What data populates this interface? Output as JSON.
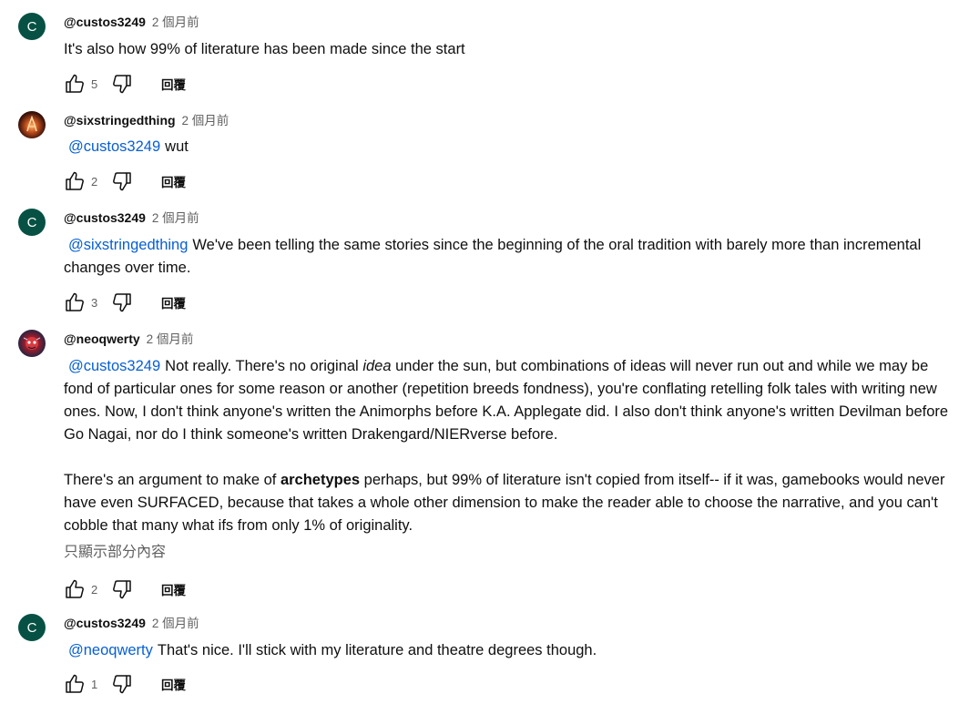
{
  "comments": [
    {
      "author": "@custos3249",
      "time": "2 個月前",
      "avatar_letter": "C",
      "mention": "",
      "text": "It's also how 99% of literature has been made since the start",
      "likes": "5",
      "reply": "回覆"
    },
    {
      "author": "@sixstringedthing",
      "time": "2 個月前",
      "mention": "@custos3249",
      "text": "wut",
      "likes": "2",
      "reply": "回覆"
    },
    {
      "author": "@custos3249",
      "time": "2 個月前",
      "avatar_letter": "C",
      "mention": "@sixstringedthing",
      "text": "We've been telling the same stories since the beginning of the oral tradition with barely more than incremental changes over time.",
      "likes": "3",
      "reply": "回覆"
    },
    {
      "author": "@neoqwerty",
      "time": "2 個月前",
      "mention": "@custos3249",
      "p1_a": "Not really. There's no original ",
      "p1_em": "idea",
      "p1_b": " under the sun, but combinations of ideas will never run out and while we may be fond of particular ones for some reason or another (repetition breeds fondness), you're conflating retelling folk tales with writing new ones. Now, I don't think anyone's written the Animorphs before K.A. Applegate did. I also don't think anyone's written Devilman before Go Nagai, nor do I think someone's written Drakengard/NIERverse before.",
      "p2_a": "There's an argument to make of ",
      "p2_strong": "archetypes",
      "p2_b": " perhaps, but 99% of literature isn't copied from itself-- if it was, gamebooks would never have even SURFACED, because that takes a whole other dimension to make the reader able to choose the narrative, and you can't cobble that many what ifs from only 1% of originality.",
      "read_more": "只顯示部分內容",
      "likes": "2",
      "reply": "回覆"
    },
    {
      "author": "@custos3249",
      "time": "2 個月前",
      "avatar_letter": "C",
      "mention": "@neoqwerty",
      "text": "That's nice. I'll stick with my literature and theatre degrees though.",
      "likes": "1",
      "reply": "回覆"
    }
  ],
  "icons": {
    "like": "thumbs-up-icon",
    "dislike": "thumbs-down-icon"
  },
  "colors": {
    "mention": "#065fd4",
    "avatar_c": "#065143",
    "secondary_text": "#606060"
  }
}
